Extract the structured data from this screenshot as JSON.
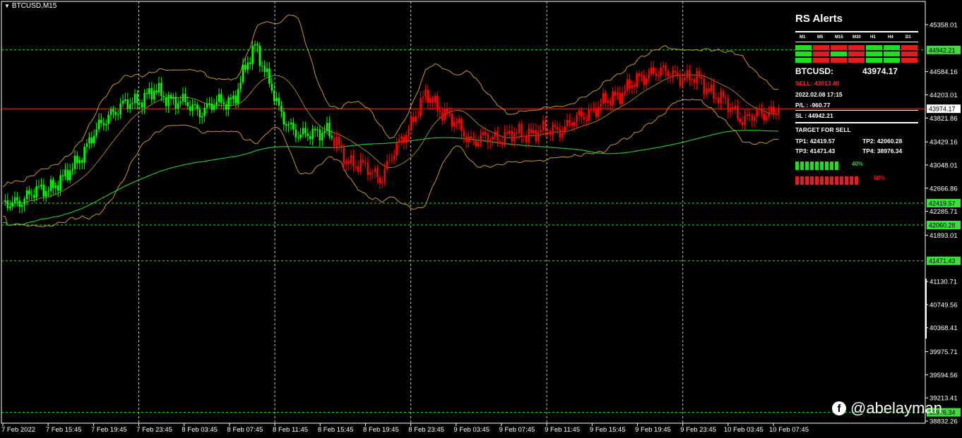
{
  "window": {
    "symbol_label": "BTCUSD,M15"
  },
  "panel": {
    "title": "RS Alerts",
    "timeframes": [
      "M1",
      "M5",
      "M15",
      "M30",
      "H1",
      "H4",
      "D1"
    ],
    "signal_grid": [
      [
        "green",
        "red",
        "red",
        "red",
        "green",
        "green",
        "red"
      ],
      [
        "green",
        "red",
        "green",
        "red",
        "green",
        "green",
        "red"
      ],
      [
        "green",
        "red",
        "red",
        "red",
        "green",
        "green",
        "red"
      ]
    ],
    "symbol": "BTCUSD:",
    "price": "43974.17",
    "sell_line": "SELL: 43013.40",
    "date_line": "2022.02.08 17:15",
    "pl_line": "P/L : -960.77",
    "sl_line": "SL : 44942.21",
    "target_header": "TARGET FOR SELL",
    "tp1": "TP1: 42419.57",
    "tp2": "TP2: 42060.28",
    "tp3": "TP3: 41471.43",
    "tp4": "TP4: 38976.34",
    "buy_pct_label": "40%",
    "sell_pct_label": "60%",
    "buy_pct": 40,
    "sell_pct": 60
  },
  "watermark": "@abelayman",
  "colors": {
    "bull": "#00ff00",
    "bear": "#ff0000",
    "band": "#c8962a",
    "ma": "#22c22c",
    "grid": "#c8c8c8"
  },
  "chart_data": {
    "type": "candlestick",
    "y_ticks": [
      "45358.01",
      "44584.16",
      "44203.01",
      "43821.86",
      "43429.16",
      "43048.01",
      "42666.86",
      "42285.71",
      "41893.01",
      "41130.71",
      "40749.56",
      "40368.41",
      "39975.71",
      "39594.56",
      "39213.41",
      "38832.26"
    ],
    "x_ticks": [
      "7 Feb 2022",
      "7 Feb 15:45",
      "7 Feb 19:45",
      "7 Feb 23:45",
      "8 Feb 03:45",
      "8 Feb 07:45",
      "8 Feb 11:45",
      "8 Feb 15:45",
      "8 Feb 19:45",
      "8 Feb 23:45",
      "9 Feb 03:45",
      "9 Feb 07:45",
      "9 Feb 11:45",
      "9 Feb 15:45",
      "9 Feb 19:45",
      "9 Feb 23:45",
      "10 Feb 03:45",
      "10 Feb 07:45"
    ],
    "level_labels": [
      {
        "value": 44942.21,
        "label": "44942.21",
        "color": "green"
      },
      {
        "value": 43974.17,
        "label": "43974.17",
        "color": "white"
      },
      {
        "value": 42419.57,
        "label": "42419.57",
        "color": "green"
      },
      {
        "value": 42060.28,
        "label": "42060.28",
        "color": "green"
      },
      {
        "value": 41471.43,
        "label": "41471.43",
        "color": "green"
      },
      {
        "value": 38976.34,
        "label": "38976.34",
        "color": "green"
      }
    ],
    "close_series": [
      {
        "time": "7 Feb 2022",
        "value": 42350
      },
      {
        "time": "7 Feb 15:45",
        "value": 42800
      },
      {
        "time": "7 Feb 19:45",
        "value": 43900
      },
      {
        "time": "7 Feb 23:45",
        "value": 44250
      },
      {
        "time": "8 Feb 03:45",
        "value": 43950
      },
      {
        "time": "8 Feb 07:45",
        "value": 44150
      },
      {
        "time": "8 Feb 07:45",
        "value": 45050
      },
      {
        "time": "8 Feb 11:45",
        "value": 43900
      },
      {
        "time": "8 Feb 11:45",
        "value": 43500
      },
      {
        "time": "8 Feb 15:45",
        "value": 43650
      },
      {
        "time": "8 Feb 15:45",
        "value": 43150
      },
      {
        "time": "8 Feb 19:45",
        "value": 42850
      },
      {
        "time": "8 Feb 23:45",
        "value": 44200
      },
      {
        "time": "9 Feb 03:45",
        "value": 43450
      },
      {
        "time": "9 Feb 07:45",
        "value": 43550
      },
      {
        "time": "9 Feb 11:45",
        "value": 43650
      },
      {
        "time": "9 Feb 15:45",
        "value": 44100
      },
      {
        "time": "9 Feb 19:45",
        "value": 44600
      },
      {
        "time": "9 Feb 23:45",
        "value": 44450
      },
      {
        "time": "10 Feb 03:45",
        "value": 43800
      },
      {
        "time": "10 Feb 07:45",
        "value": 43974.17
      }
    ],
    "grid": true,
    "legend": "none"
  }
}
